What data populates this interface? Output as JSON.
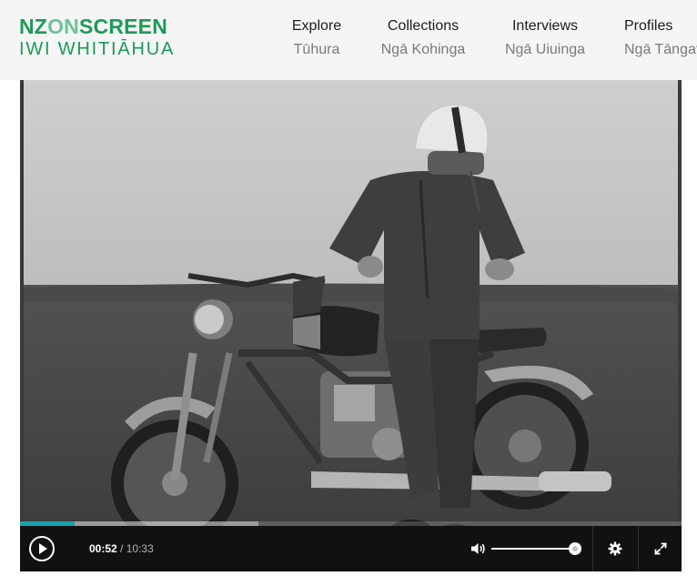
{
  "brand": {
    "logo_nz": "NZ",
    "logo_on": "ON",
    "logo_screen": "SCREEN",
    "logo_subtitle": "IWI WHITIĀHUA",
    "colors": {
      "primary": "#1d9a57",
      "light": "#6ec398"
    }
  },
  "nav": {
    "items": [
      {
        "label": "Explore",
        "sublabel": "Tūhura"
      },
      {
        "label": "Collections",
        "sublabel": "Ngā Kohinga"
      },
      {
        "label": "Interviews",
        "sublabel": "Ngā Uiuinga"
      },
      {
        "label": "Profiles",
        "sublabel": "Ngā Tāngat"
      }
    ]
  },
  "player": {
    "current_time": "00:52",
    "separator": "/",
    "duration": "10:33",
    "played_fraction": 0.082,
    "buffered_fraction": 0.36,
    "volume_fraction": 1.0,
    "accent_color": "#1aa2a7",
    "icons": {
      "play": "play-icon",
      "volume": "volume-icon",
      "settings": "gear-icon",
      "fullscreen": "fullscreen-icon"
    }
  }
}
